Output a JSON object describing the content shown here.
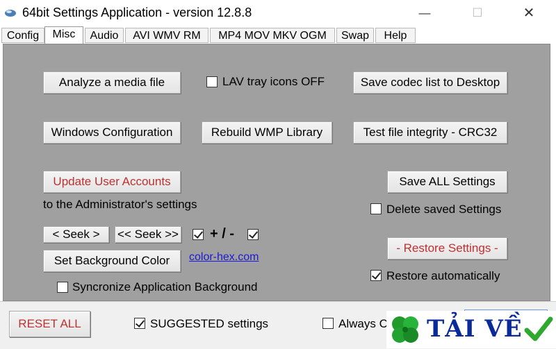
{
  "window": {
    "title": "64bit Settings Application - version 12.8.8",
    "minimize_glyph": "—",
    "maximize_glyph": "☐",
    "close_glyph": "✕"
  },
  "tabs": [
    {
      "label": "Config"
    },
    {
      "label": "Misc",
      "active": true
    },
    {
      "label": "Audio"
    },
    {
      "label": "AVI WMV RM"
    },
    {
      "label": "MP4 MOV MKV OGM"
    },
    {
      "label": "Swap"
    },
    {
      "label": "Help"
    }
  ],
  "misc": {
    "analyze_button": "Analyze a media file",
    "lav_tray_label": "LAV tray icons OFF",
    "lav_tray_checked": false,
    "save_codec_button": "Save codec list to Desktop",
    "windows_config_button": "Windows Configuration",
    "rebuild_wmp_button": "Rebuild WMP Library",
    "test_integrity_button": "Test file integrity - CRC32",
    "update_accounts_button": "Update User Accounts",
    "update_accounts_note": "to the Administrator's settings",
    "save_all_button": "Save ALL Settings",
    "delete_saved_label": "Delete saved Settings",
    "delete_saved_checked": false,
    "seek_button": "<  Seek  >",
    "seek_far_button": "<< Seek >>",
    "plus_minus_label": "+ / -",
    "seek_check_1": true,
    "seek_check_2": true,
    "restore_button": "- Restore Settings -",
    "set_bg_button": "Set Background Color",
    "color_link": "color-hex.com",
    "restore_auto_label": "Restore automatically",
    "restore_auto_checked": true,
    "sync_bg_label": "Syncronize Application Background",
    "sync_bg_checked": false
  },
  "bottom": {
    "reset_all_button": "RESET ALL",
    "suggested_label": "SUGGESTED settings",
    "suggested_checked": true,
    "always_label": "Always C"
  },
  "watermark": {
    "text": "TẢI VỀ"
  },
  "colors": {
    "panel_bg": "#a0a0a0",
    "accent_red": "#c03030",
    "link_blue": "#1a1ad6",
    "watermark_blue": "#0a2a9a",
    "watermark_green": "#2fa82f"
  }
}
